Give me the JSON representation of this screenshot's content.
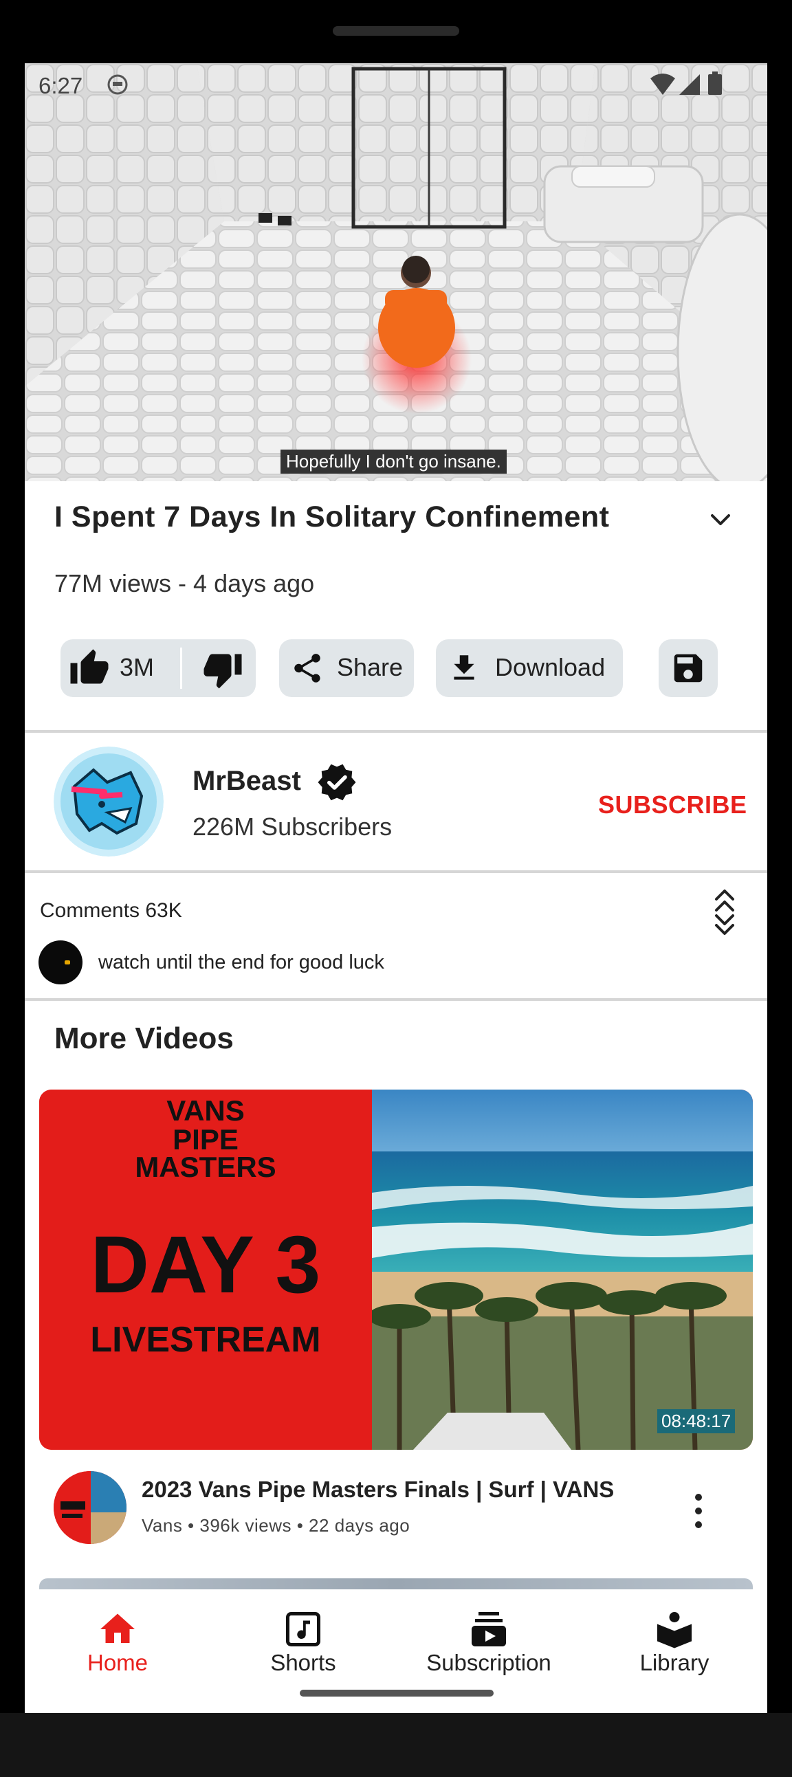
{
  "status_bar": {
    "time": "6:27"
  },
  "video": {
    "caption": "Hopefully I don't go insane.",
    "title": "I Spent 7 Days In Solitary Confinement",
    "meta": "77M views - 4 days ago"
  },
  "actions": {
    "like_count": "3M",
    "share_label": "Share",
    "download_label": "Download"
  },
  "channel": {
    "name": "MrBeast",
    "subscribers": "226M Subscribers",
    "subscribe_label": "SUBSCRIBE"
  },
  "comments": {
    "header": "Comments 63K",
    "top_comment": "watch until the end for good luck"
  },
  "more_videos": {
    "heading": "More Videos",
    "items": [
      {
        "thumb_brand": "VANS",
        "thumb_line1": "PIPE",
        "thumb_line2": "MASTERS",
        "thumb_day": "DAY 3",
        "thumb_live": "LIVESTREAM",
        "duration": "08:48:17",
        "title": "2023 Vans Pipe Masters Finals | Surf | VANS",
        "meta": "Vans  •  396k views  •  22 days ago"
      }
    ]
  },
  "nav": {
    "items": [
      {
        "label": "Home",
        "icon": "home-icon",
        "active": true
      },
      {
        "label": "Shorts",
        "icon": "shorts-icon"
      },
      {
        "label": "Subscription",
        "icon": "subscription-icon"
      },
      {
        "label": "Library",
        "icon": "library-icon"
      }
    ]
  },
  "colors": {
    "accent": "#e8201c",
    "pill_bg": "#e1e6e9",
    "duration_bg": "#1a6a78"
  }
}
